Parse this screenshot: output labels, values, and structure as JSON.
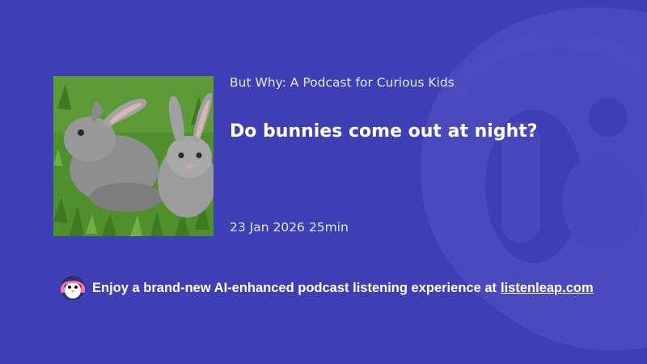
{
  "podcast": {
    "name": "But Why: A Podcast for Curious Kids"
  },
  "episode": {
    "title": "Do bunnies come out at night?",
    "date": "23 Jan 2026",
    "duration": "25min",
    "cover_art": "rabbits-photo"
  },
  "promo": {
    "text": "Enjoy a brand-new AI-enhanced podcast listening experience at",
    "link_label": "listenleap.com",
    "icon": "penguin-headphones-icon"
  },
  "colors": {
    "background": "#3f3fb5",
    "watermark": "#5656c3"
  },
  "watermark_icon": "listenleap-logo-icon"
}
